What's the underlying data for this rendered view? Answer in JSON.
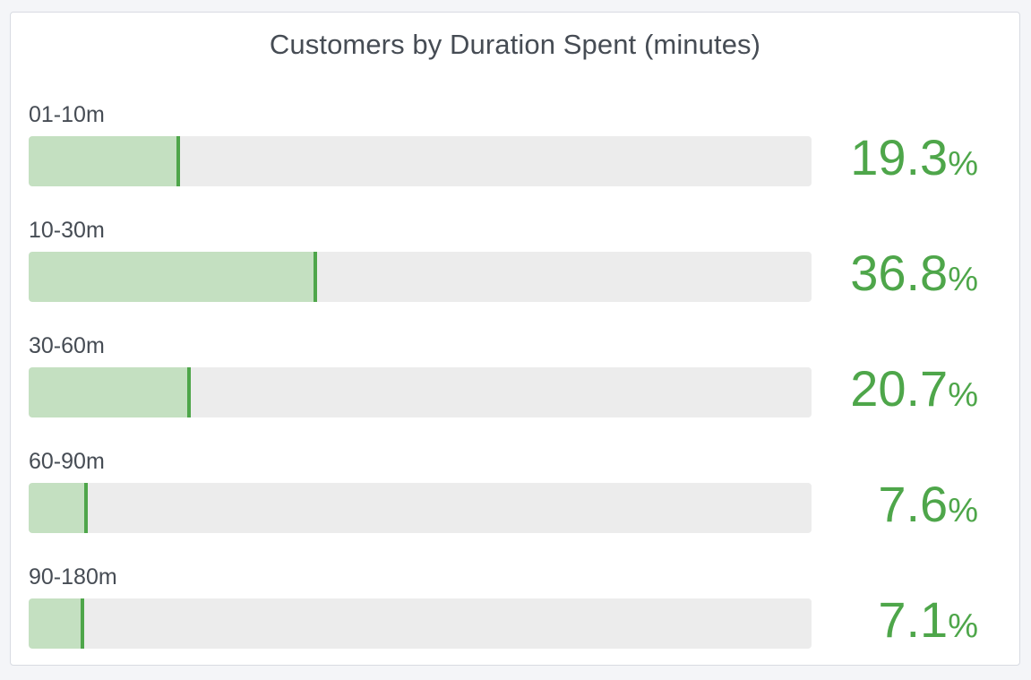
{
  "colors": {
    "fill": "#c4e0c1",
    "fill_edge": "#4ea64a",
    "track": "#ececec",
    "value_text": "#4ea64a",
    "label_text": "#464c54"
  },
  "chart_data": {
    "type": "bar",
    "orientation": "horizontal",
    "title": "Customers by Duration Spent (minutes)",
    "unit": "%",
    "categories": [
      "01-10m",
      "10-30m",
      "30-60m",
      "60-90m",
      "90-180m"
    ],
    "values": [
      19.3,
      36.8,
      20.7,
      7.6,
      7.1
    ],
    "value_labels": [
      "19.3",
      "36.8",
      "20.7",
      "7.6",
      "7.1"
    ],
    "xlim": [
      0,
      100
    ],
    "grid": false,
    "legend": "none"
  }
}
